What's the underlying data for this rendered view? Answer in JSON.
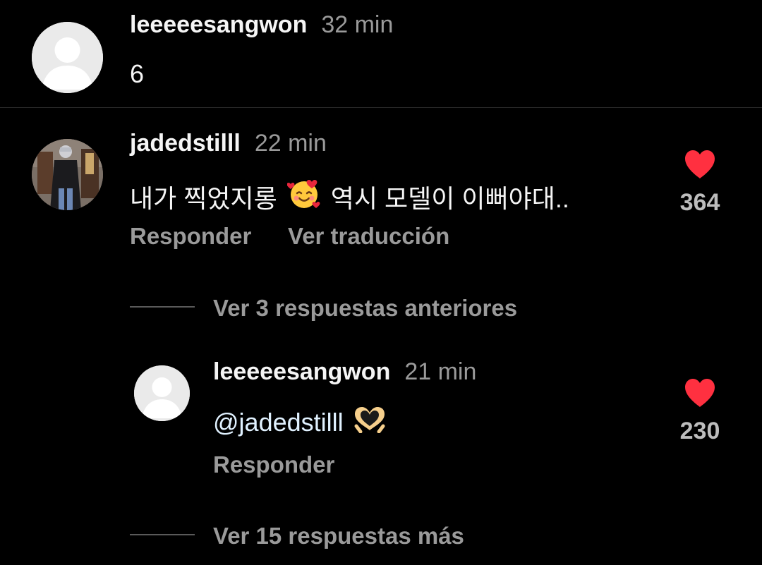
{
  "comments": [
    {
      "username": "leeeeesangwon",
      "time": "32 min",
      "text": "6"
    },
    {
      "username": "jadedstilll",
      "time": "22 min",
      "text_before": "내가 찍었지롱",
      "emoji": "smiling-face-with-hearts",
      "text_after": "역시 모델이 이뻐야대..",
      "likes": "364",
      "reply_label": "Responder",
      "translate_label": "Ver traducción",
      "view_previous_replies": "Ver 3 respuestas anteriores",
      "reply": {
        "username": "leeeeesangwon",
        "time": "21 min",
        "mention": "@jadedstilll",
        "emoji": "heart-hands",
        "likes": "230",
        "reply_label": "Responder"
      },
      "view_more_replies": "Ver 15 respuestas más"
    }
  ],
  "colors": {
    "background": "#000000",
    "heart": "#ff3040",
    "muted_text": "#9a9a9a"
  }
}
